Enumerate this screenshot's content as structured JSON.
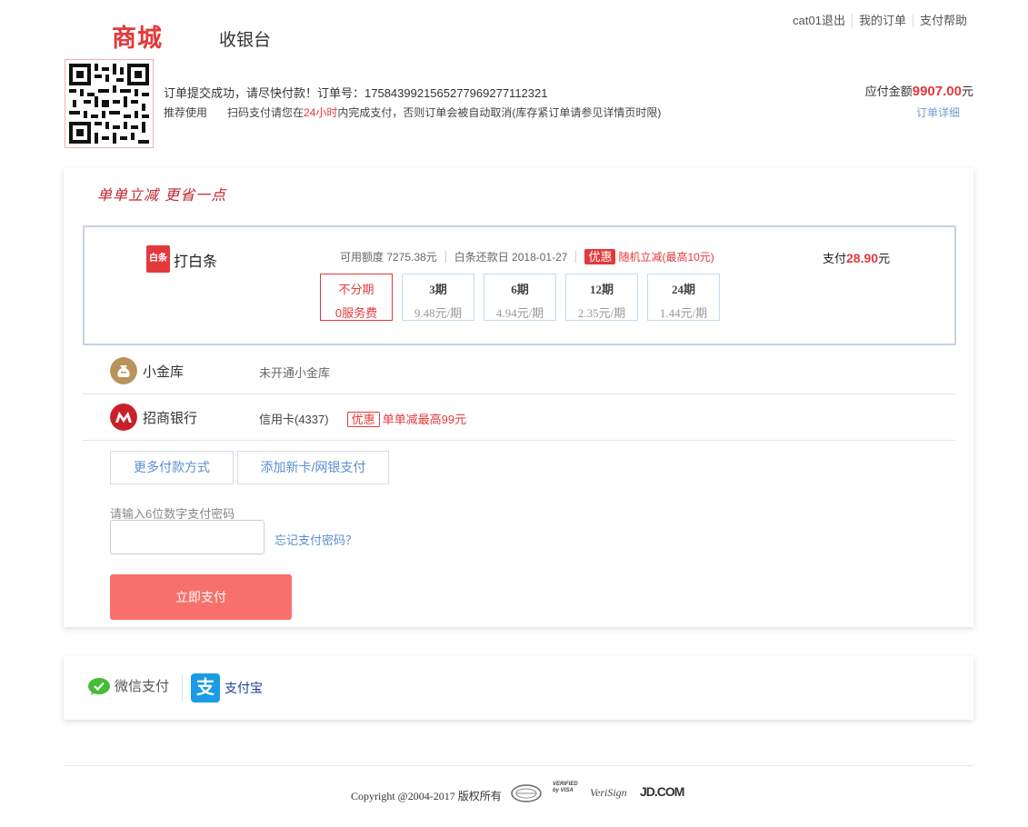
{
  "header": {
    "logo": "商城",
    "subtitle": "收银台",
    "nav": [
      "cat01退出",
      "我的订单",
      "支付帮助"
    ]
  },
  "order": {
    "message": "订单提交成功，请尽快付款！订单号：1758439921565277969277112321",
    "recommend": "推荐使用",
    "hint_prefix": "扫码支付请您在",
    "hint_time": "24小时",
    "hint_suffix": "内完成支付，否则订单会被自动取消(库存紧订单请参见详情页时限)",
    "amount_label": "应付金额",
    "amount_value": "9907.00",
    "amount_unit": "元",
    "detail_link": "订单详细"
  },
  "card": {
    "slogan": "单单立减 更省一点",
    "baitiao": {
      "logo_text": "白条",
      "title": "打白条",
      "credit": "可用额度 7275.38元",
      "repay": "白条还款日 2018-01-27",
      "promo_tag": "优惠",
      "promo_text": "随机立减(最高10元)",
      "pay_label": "支付",
      "pay_value": "28.90",
      "pay_unit": "元",
      "installments": [
        {
          "period": "不分期",
          "fee": "0服务费",
          "selected": true
        },
        {
          "period": "3期",
          "fee": "9.48元/期",
          "selected": false
        },
        {
          "period": "6期",
          "fee": "4.94元/期",
          "selected": false
        },
        {
          "period": "12期",
          "fee": "2.35元/期",
          "selected": false
        },
        {
          "period": "24期",
          "fee": "1.44元/期",
          "selected": false
        }
      ]
    },
    "xiaojinku": {
      "name": "小金库",
      "desc": "未开通小金库"
    },
    "cmb": {
      "name": "招商银行",
      "card": "信用卡(4337)",
      "promo_tag": "优惠",
      "promo_text": "单单减最高99元"
    },
    "more_button": "更多付款方式",
    "add_card_button": "添加新卡/网银支付",
    "pwd_label": "请输入6位数字支付密码",
    "forgot": "忘记支付密码？",
    "pay_button": "立即支付"
  },
  "third_party": {
    "wechat": "微信支付",
    "alipay": "支付宝",
    "alipay_icon_char": "支"
  },
  "footer": {
    "copyright": "Copyright @2004-2017 版权所有",
    "certs": [
      "VERIFIED by VISA",
      "VeriSign",
      "JD.COM"
    ]
  },
  "colors": {
    "brand_red": "#e4393c",
    "pay_button": "#f7706b",
    "link_blue": "#5a8ed0",
    "alipay_blue": "#1a9be6",
    "wechat_green": "#46bb36"
  },
  "icons": [
    "qr-code",
    "baitiao-logo",
    "money-bag-icon",
    "cmb-bank-icon",
    "wechat-icon",
    "alipay-icon"
  ]
}
